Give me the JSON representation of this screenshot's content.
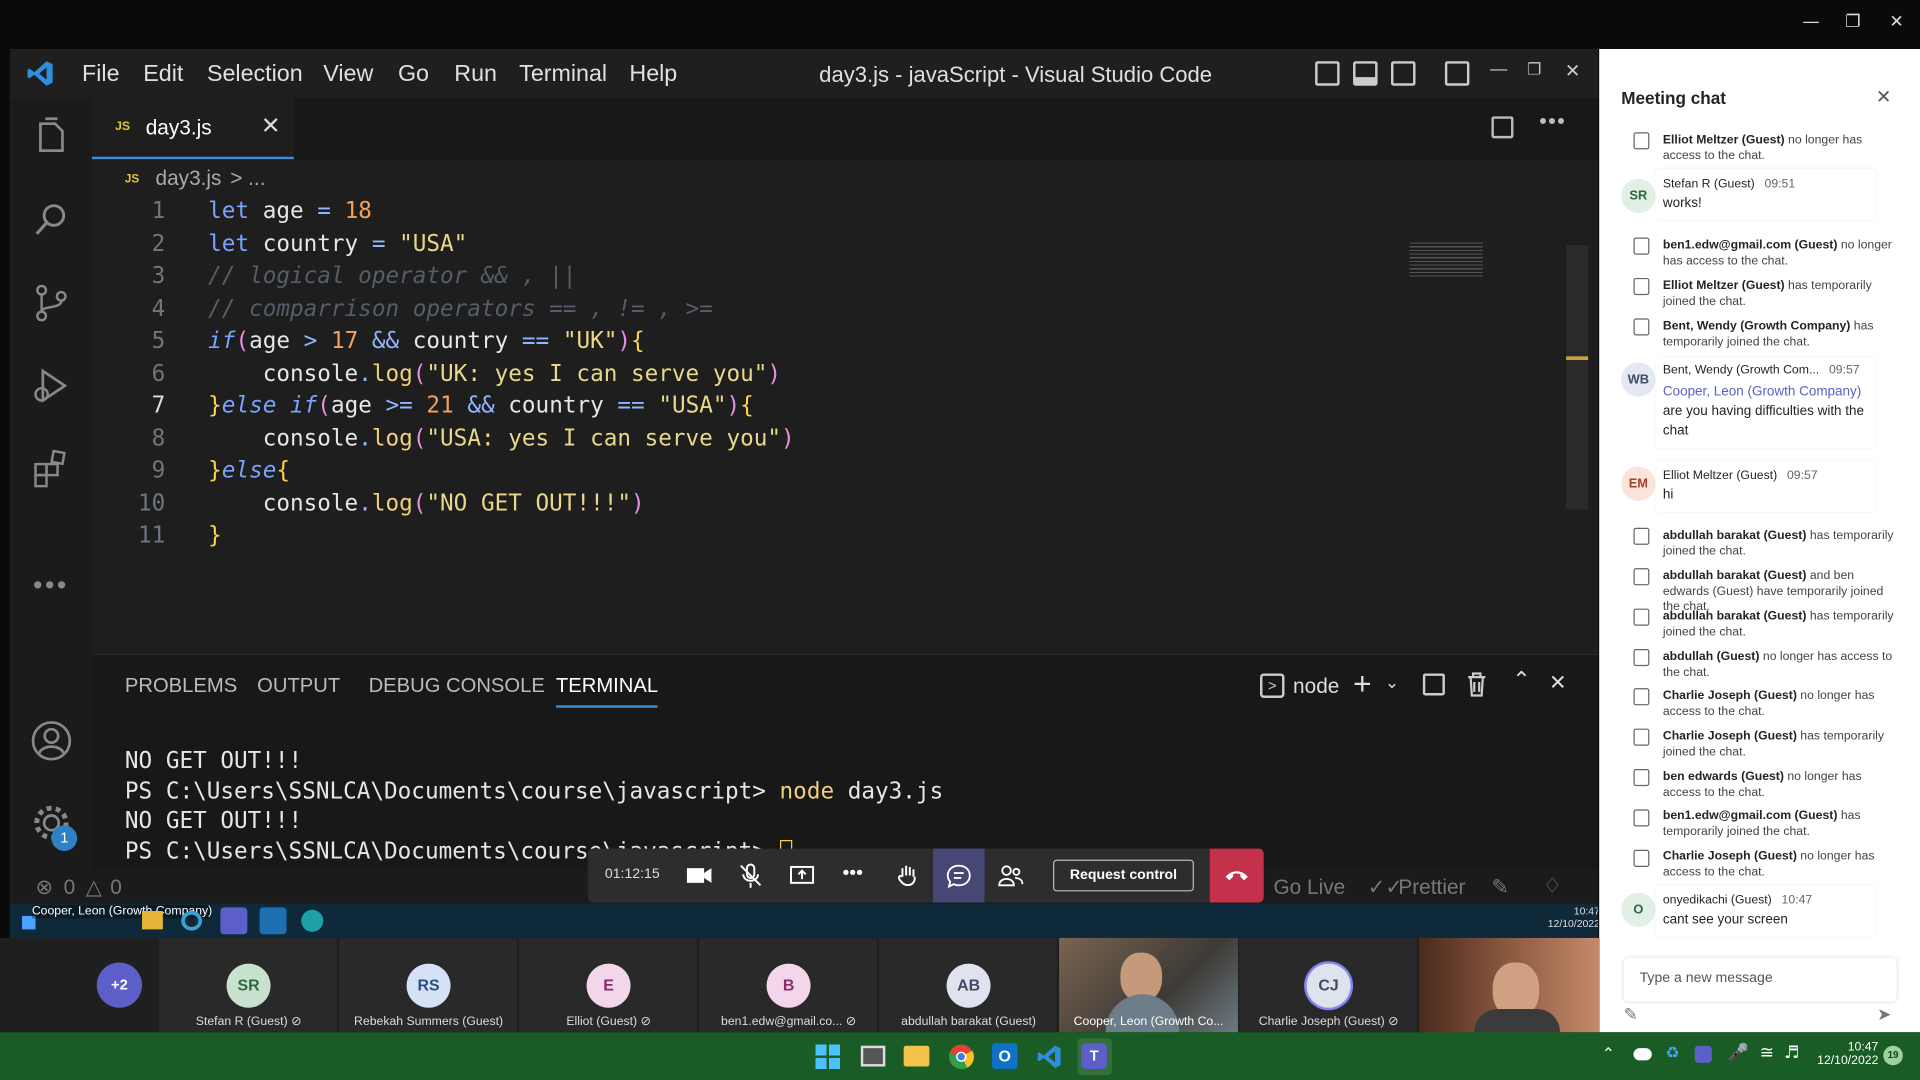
{
  "vscode": {
    "title": "day3.js - javaScript - Visual Studio Code",
    "menus": [
      "File",
      "Edit",
      "Selection",
      "View",
      "Go",
      "Run",
      "Terminal",
      "Help"
    ],
    "tab_label": "day3.js",
    "breadcrumb_file": "day3.js",
    "breadcrumb_rest": "> ...",
    "file_badge": "JS",
    "settings_badge": "1",
    "code_lines": [
      "let age = 18",
      "let country = \"USA\"",
      "// logical operator && , ||",
      "// comparrison operators == , != , >=",
      "if(age > 17 && country == \"UK\"){",
      "    console.log(\"UK: yes I can serve you\")",
      "}else if(age >= 21 && country == \"USA\"){",
      "    console.log(\"USA: yes I can serve you\")",
      "}else{",
      "    console.log(\"NO GET OUT!!!\")",
      "}"
    ],
    "line_numbers": [
      "1",
      "2",
      "3",
      "4",
      "5",
      "6",
      "7",
      "8",
      "9",
      "10",
      "11"
    ],
    "panel_tabs": [
      "PROBLEMS",
      "OUTPUT",
      "DEBUG CONSOLE",
      "TERMINAL"
    ],
    "terminal_shell": "node",
    "terminal_lines": [
      "NO GET OUT!!!",
      "PS C:\\Users\\SSNLCA\\Documents\\course\\javascript> node day3.js",
      "NO GET OUT!!!",
      "PS C:\\Users\\SSNLCA\\Documents\\course\\javascript> "
    ],
    "status": {
      "errors": "0",
      "warnings": "0",
      "go_live": "Go Live",
      "prettier": "Prettier"
    },
    "inner_taskbar": {
      "presenter": "Cooper, Leon (Growth Company)",
      "time": "10:47",
      "date": "12/10/2022"
    }
  },
  "call": {
    "timer": "01:12:15",
    "request_control": "Request control"
  },
  "chat": {
    "title": "Meeting chat",
    "input_placeholder": "Type a new message",
    "items": [
      {
        "kind": "sys",
        "name": "Elliot Meltzer (Guest)",
        "text": "no longer has access to the chat."
      },
      {
        "kind": "msg",
        "initials": "SR",
        "name": "Stefan R (Guest)",
        "time": "09:51",
        "text": "works!"
      },
      {
        "kind": "sys",
        "name": "ben1.edw@gmail.com (Guest)",
        "text": "no longer has access to the chat."
      },
      {
        "kind": "sys",
        "name": "Elliot Meltzer (Guest)",
        "text": "has temporarily joined the chat."
      },
      {
        "kind": "sys",
        "name": "Bent, Wendy (Growth Company)",
        "text": "has temporarily joined the chat."
      },
      {
        "kind": "msg",
        "initials": "WB",
        "name": "Bent, Wendy (Growth Com...",
        "time": "09:57",
        "mention": "Cooper, Leon (Growth Company)",
        "text": "are you having difficulties with the chat"
      },
      {
        "kind": "msg",
        "initials": "EM",
        "name": "Elliot Meltzer (Guest)",
        "time": "09:57",
        "text": "hi"
      },
      {
        "kind": "sys",
        "name": "abdullah barakat (Guest)",
        "text": "has temporarily joined the chat."
      },
      {
        "kind": "sys",
        "name": "abdullah barakat (Guest)",
        "text": "and ben edwards (Guest) have temporarily joined the chat."
      },
      {
        "kind": "sys",
        "name": "abdullah barakat (Guest)",
        "text": "has temporarily joined the chat."
      },
      {
        "kind": "sys",
        "name": "abdullah (Guest)",
        "text": "no longer has access to the chat."
      },
      {
        "kind": "sys",
        "name": "Charlie Joseph (Guest)",
        "text": "no longer has access to the chat."
      },
      {
        "kind": "sys",
        "name": "Charlie Joseph (Guest)",
        "text": "has temporarily joined the chat."
      },
      {
        "kind": "sys",
        "name": "ben edwards (Guest)",
        "text": "no longer has access to the chat."
      },
      {
        "kind": "sys",
        "name": "ben1.edw@gmail.com (Guest)",
        "text": "has temporarily joined the chat."
      },
      {
        "kind": "sys",
        "name": "Charlie Joseph (Guest)",
        "text": "no longer has access to the chat."
      },
      {
        "kind": "msg",
        "initials": "O",
        "name": "onyedikachi (Guest)",
        "time": "10:47",
        "text": "cant see your screen"
      }
    ]
  },
  "participants": {
    "overflow": "+2",
    "list": [
      {
        "initials": "SR",
        "name": "Stefan R (Guest)",
        "color": "#c9e2cf",
        "fg": "#2d6a3e"
      },
      {
        "initials": "RS",
        "name": "Rebekah Summers (Guest)",
        "color": "#d5e2f5",
        "fg": "#2b4c7e"
      },
      {
        "initials": "E",
        "name": "Elliot (Guest)",
        "color": "#f4d6ea",
        "fg": "#8a2c6c"
      },
      {
        "initials": "B",
        "name": "ben1.edw@gmail.co...",
        "color": "#f4d6ea",
        "fg": "#8a2c6c"
      },
      {
        "initials": "AB",
        "name": "abdullah barakat (Guest)",
        "color": "#dfe3ee",
        "fg": "#3e4a66"
      },
      {
        "initials": "",
        "name": "Cooper, Leon (Growth Co...",
        "color": "",
        "fg": ""
      },
      {
        "initials": "CJ",
        "name": "Charlie Joseph (Guest)",
        "color": "#dfe3ee",
        "fg": "#3e4a66"
      }
    ]
  },
  "system_tray": {
    "time": "10:47",
    "date": "12/10/2022",
    "notif_count": "19"
  }
}
